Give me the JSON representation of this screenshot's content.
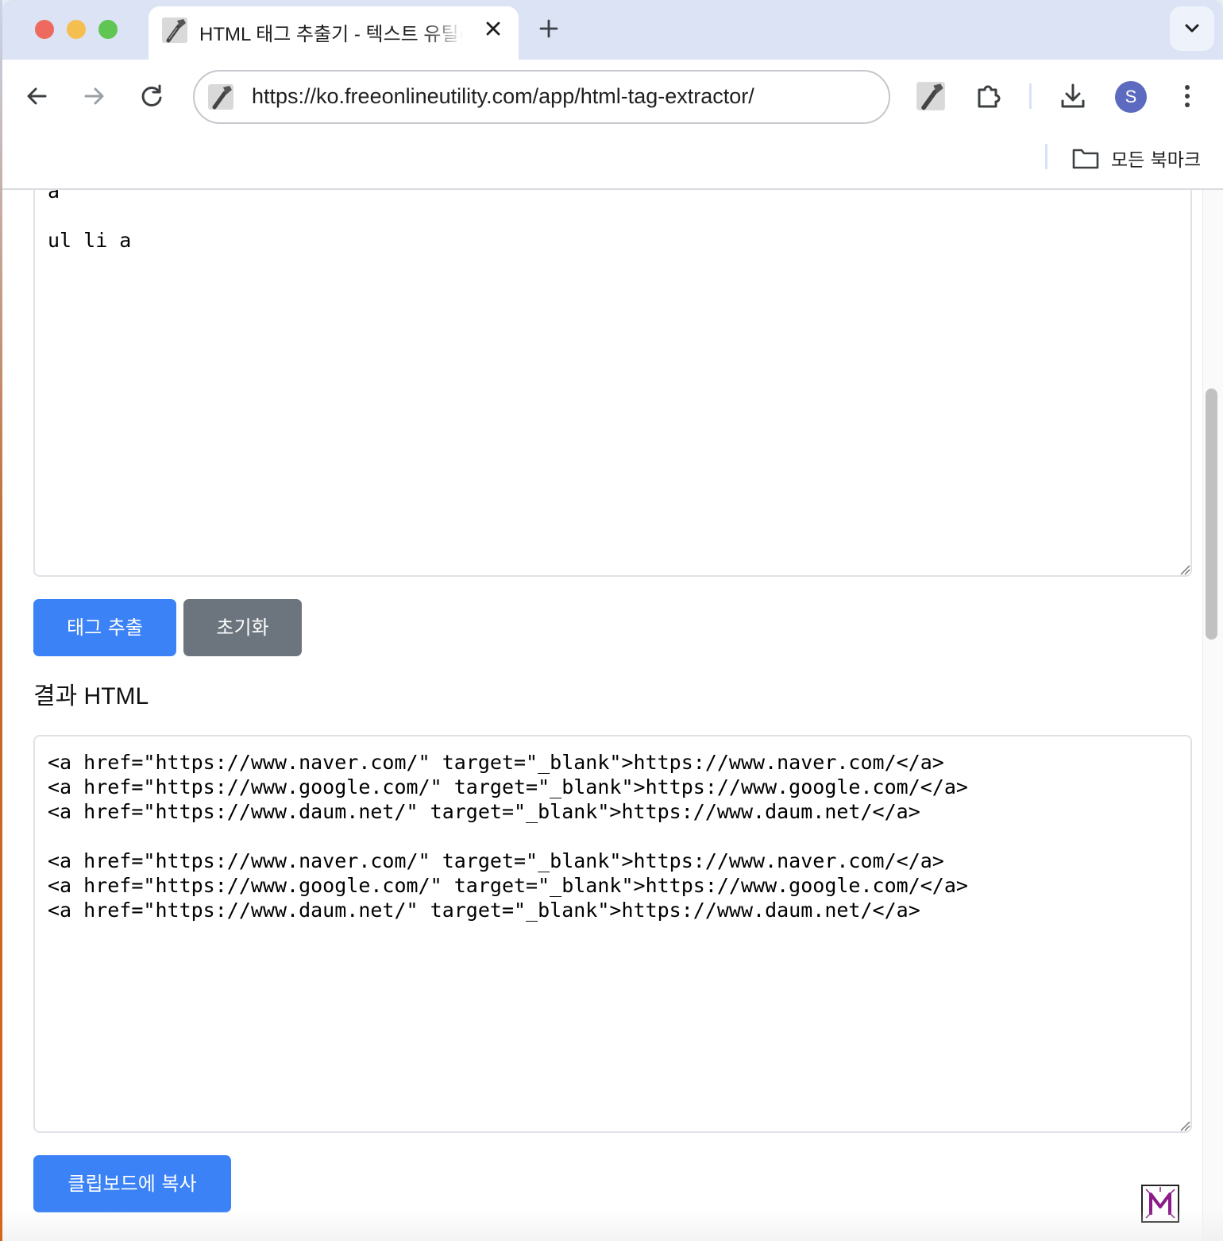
{
  "browser": {
    "tab": {
      "title": "HTML 태그 추출기 - 텍스트 유틸리티"
    },
    "url": "https://ko.freeonlineutility.com/app/html-tag-extractor/",
    "profile_initial": "S",
    "bookmarks_label": "모든 북마크"
  },
  "icons": {
    "favicon": "wrench-icon",
    "tab_close": "close-icon",
    "new_tab": "plus-icon",
    "tab_search": "chevron-down-icon",
    "back": "arrow-left-icon",
    "forward": "arrow-right-icon",
    "reload": "reload-icon",
    "extensions": "puzzle-icon",
    "downloads": "download-icon",
    "menu": "kebab-menu-icon",
    "bookmarks_folder": "folder-icon"
  },
  "app": {
    "input_text": "a\n\nul li a",
    "extract_button": "태그 추출",
    "reset_button": "초기화",
    "result_heading": "결과 HTML",
    "output_text": "<a href=\"https://www.naver.com/\" target=\"_blank\">https://www.naver.com/</a>\n<a href=\"https://www.google.com/\" target=\"_blank\">https://www.google.com/</a>\n<a href=\"https://www.daum.net/\" target=\"_blank\">https://www.daum.net/</a>\n\n<a href=\"https://www.naver.com/\" target=\"_blank\">https://www.naver.com/</a>\n<a href=\"https://www.google.com/\" target=\"_blank\">https://www.google.com/</a>\n<a href=\"https://www.daum.net/\" target=\"_blank\">https://www.daum.net/</a>",
    "copy_button": "클립보드에 복사"
  },
  "colors": {
    "primary": "#3b82f6",
    "secondary": "#6c757d",
    "tabstrip": "#dbe3f4",
    "avatar": "#5c6bc0"
  }
}
